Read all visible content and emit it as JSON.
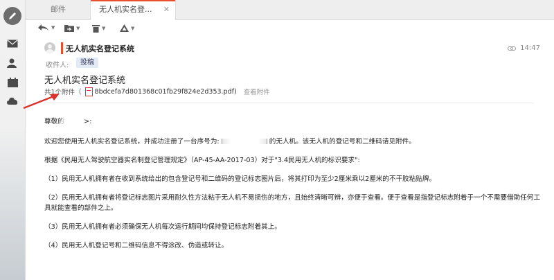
{
  "tabs": [
    {
      "label": "邮件"
    },
    {
      "label": "无人机实名登...",
      "close": "✕"
    }
  ],
  "message": {
    "sender": "无人机实名登记系统",
    "time": "14:47",
    "to_label": "收件人:",
    "to_value": "投稿",
    "subject": "无人机实名登记系统",
    "attachments": {
      "count_label": "共1个附件（",
      "file": "8bdcefa7d801368c01fb29f824e2d353.pdf)",
      "view_label": "查看附件"
    }
  },
  "body": {
    "greeting_prefix": "尊敬的",
    "greeting_suffix": ">:",
    "p1_prefix": "欢迎您使用无人机实名登记系统，并成功注册了一台序号为: ",
    "p1_suffix": " 的无人机。该无人机的登记号和二维码请见附件。",
    "p2": "根据《民用无人驾驶航空器实名制登记管理规定》（AP-45-AA-2017-03）对于\"3.4民用无人机的标识要求\":",
    "p3": "（1）民用无人机拥有者在收到系统给出的包含登记号和二维码的登记标志图片后，将其打印为至少2厘米乘以2厘米的不干胶粘贴牌。",
    "p4": "（2）民用无人机拥有者将登记标志图片采用耐久性方法粘于无人机不易损伤的地方，且始终清晰可辨，亦便于查看。便于查看是指登记标志附着于一个不需要借助任何工具就能查看的部件之上。",
    "p5": "（3）民用无人机拥有者必须确保无人机每次运行期间均保持登记标志附着其上。",
    "p6": "（4）民用无人机登记号和二维码信息不得涂改、伪造或转让。"
  },
  "colors": {
    "accent": "#e8502d",
    "arrow": "#d9342b"
  }
}
